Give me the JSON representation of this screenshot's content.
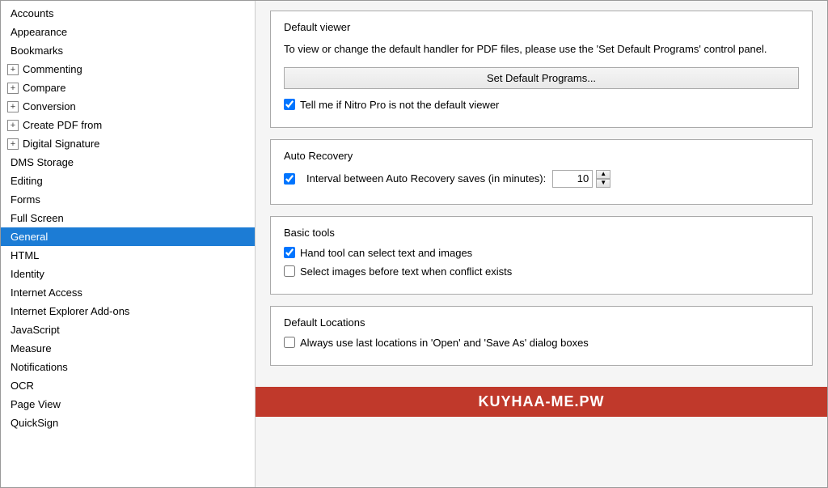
{
  "sidebar": {
    "items": [
      {
        "id": "accounts",
        "label": "Accounts",
        "indent": "normal",
        "expand": false,
        "active": false
      },
      {
        "id": "appearance",
        "label": "Appearance",
        "indent": "normal",
        "expand": false,
        "active": false
      },
      {
        "id": "bookmarks",
        "label": "Bookmarks",
        "indent": "normal",
        "expand": false,
        "active": false
      },
      {
        "id": "commenting",
        "label": "Commenting",
        "indent": "normal",
        "expand": true,
        "active": false
      },
      {
        "id": "compare",
        "label": "Compare",
        "indent": "normal",
        "expand": true,
        "active": false
      },
      {
        "id": "conversion",
        "label": "Conversion",
        "indent": "normal",
        "expand": true,
        "active": false
      },
      {
        "id": "create-pdf-from",
        "label": "Create PDF from",
        "indent": "normal",
        "expand": true,
        "active": false
      },
      {
        "id": "digital-signature",
        "label": "Digital Signature",
        "indent": "normal",
        "expand": true,
        "active": false
      },
      {
        "id": "dms-storage",
        "label": "DMS Storage",
        "indent": "normal",
        "expand": false,
        "active": false
      },
      {
        "id": "editing",
        "label": "Editing",
        "indent": "normal",
        "expand": false,
        "active": false
      },
      {
        "id": "forms",
        "label": "Forms",
        "indent": "normal",
        "expand": false,
        "active": false
      },
      {
        "id": "full-screen",
        "label": "Full Screen",
        "indent": "normal",
        "expand": false,
        "active": false
      },
      {
        "id": "general",
        "label": "General",
        "indent": "normal",
        "expand": false,
        "active": true
      },
      {
        "id": "html",
        "label": "HTML",
        "indent": "normal",
        "expand": false,
        "active": false
      },
      {
        "id": "identity",
        "label": "Identity",
        "indent": "normal",
        "expand": false,
        "active": false
      },
      {
        "id": "internet-access",
        "label": "Internet Access",
        "indent": "normal",
        "expand": false,
        "active": false
      },
      {
        "id": "internet-explorer-addons",
        "label": "Internet Explorer Add-ons",
        "indent": "normal",
        "expand": false,
        "active": false
      },
      {
        "id": "javascript",
        "label": "JavaScript",
        "indent": "normal",
        "expand": false,
        "active": false
      },
      {
        "id": "measure",
        "label": "Measure",
        "indent": "normal",
        "expand": false,
        "active": false
      },
      {
        "id": "notifications",
        "label": "Notifications",
        "indent": "normal",
        "expand": false,
        "active": false
      },
      {
        "id": "ocr",
        "label": "OCR",
        "indent": "normal",
        "expand": false,
        "active": false
      },
      {
        "id": "page-view",
        "label": "Page View",
        "indent": "normal",
        "expand": false,
        "active": false
      },
      {
        "id": "quicksign",
        "label": "QuickSign",
        "indent": "normal",
        "expand": false,
        "active": false
      }
    ]
  },
  "content": {
    "default_viewer": {
      "label": "Default viewer",
      "description": "To view or change the default handler for PDF files, please use the 'Set Default Programs' control panel.",
      "set_default_btn": "Set Default Programs...",
      "checkbox_label": "Tell me if Nitro Pro is not the default viewer",
      "checkbox_checked": true
    },
    "auto_recovery": {
      "label": "Auto Recovery",
      "interval_label": "Interval between Auto Recovery saves (in minutes):",
      "interval_value": "10",
      "interval_checked": true
    },
    "basic_tools": {
      "label": "Basic tools",
      "hand_tool_label": "Hand tool can select text and images",
      "hand_tool_checked": true,
      "select_images_label": "Select images before text when conflict exists",
      "select_images_checked": false
    },
    "default_locations": {
      "label": "Default Locations",
      "always_use_last_label": "Always use last locations in 'Open' and 'Save As' dialog boxes",
      "always_use_last_checked": false
    }
  },
  "watermark": {
    "text": "KUYHAA-ME.PW"
  }
}
